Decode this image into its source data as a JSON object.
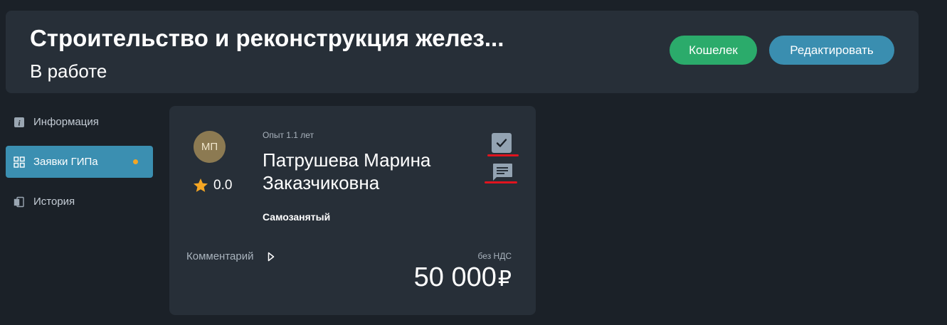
{
  "header": {
    "title": "Строительство и реконструкция желез...",
    "status": "В работе",
    "wallet_button": "Кошелек",
    "edit_button": "Редактировать"
  },
  "sidebar": {
    "items": [
      {
        "label": "Информация",
        "icon": "info-icon"
      },
      {
        "label": "Заявки ГИПа",
        "icon": "grid-icon",
        "active": true
      },
      {
        "label": "История",
        "icon": "history-icon"
      }
    ]
  },
  "card": {
    "avatar_initials": "МП",
    "rating": "0.0",
    "experience": "Опыт 1.1 лет",
    "name": "Патрушева Марина Заказчиковна",
    "tax_status": "Самозанятый",
    "comment_label": "Комментарий",
    "vat_label": "без НДС",
    "price": "50 000",
    "currency": "₽"
  },
  "colors": {
    "background": "#1b2128",
    "panel": "#272f38",
    "wallet": "#2bab6b",
    "accent": "#3a8eb0",
    "highlight": "#e0141e",
    "star": "#f5a623"
  }
}
